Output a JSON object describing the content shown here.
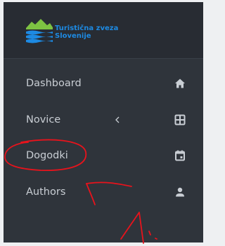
{
  "brand": {
    "name_line1": "Turistična zveza",
    "name_line2": "Slovenije"
  },
  "nav": {
    "items": [
      {
        "label": "Dashboard",
        "icon": "home-icon"
      },
      {
        "label": "Novice",
        "icon": "grid-icon",
        "chevron": "chevron-left-icon"
      },
      {
        "label": "Dogodki",
        "icon": "calendar-icon"
      },
      {
        "label": "Authors",
        "icon": "user-icon"
      }
    ]
  },
  "colors": {
    "sidebar_bg": "#2f343b",
    "brand_bg": "#282c33",
    "brand_text": "#1d8ae3",
    "logo_green": "#7dc242",
    "logo_blue": "#1d8ae3",
    "nav_text": "#c9ced4",
    "annotation_red": "#e8131c"
  }
}
